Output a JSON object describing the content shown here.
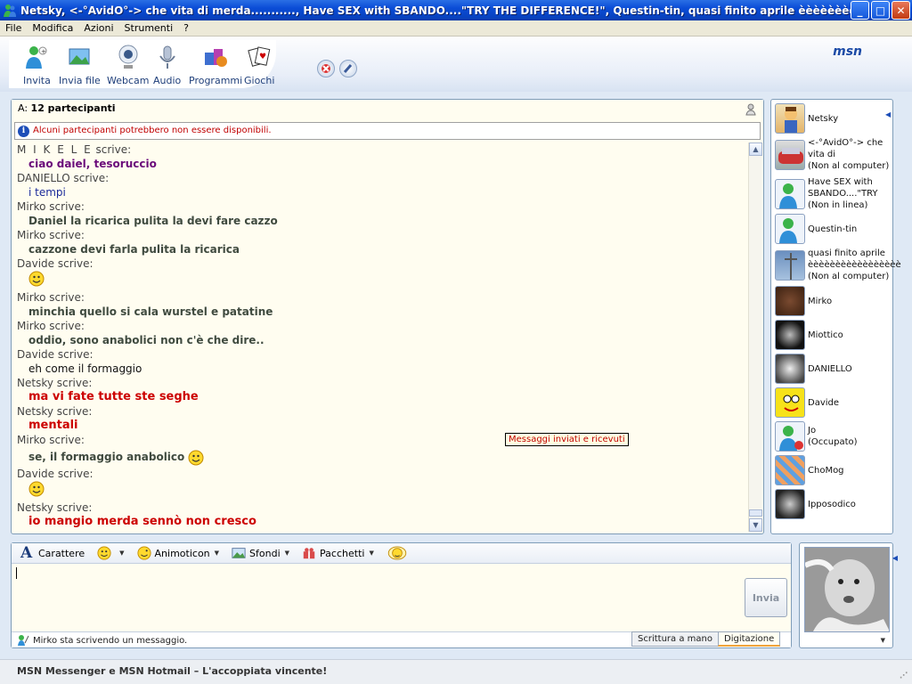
{
  "window": {
    "title": "Netsky, <-°AvidO°->  che vita di merda..........., Have SEX with SBANDO....\"TRY THE DIFFERENCE!\", Questin-tin, quasi finito aprile èèèèèèèèèèèèèèèèèèèèèèèèèèèèè..."
  },
  "menu": [
    "File",
    "Modifica",
    "Azioni",
    "Strumenti",
    "?"
  ],
  "toolbar": {
    "invite": "Invita",
    "send_file": "Invia file",
    "webcam": "Webcam",
    "audio": "Audio",
    "programs": "Programmi",
    "games": "Giochi",
    "logo": "msn"
  },
  "conversation": {
    "to_label": "A:",
    "participants": "12 partecipanti",
    "warning": "Alcuni partecipanti potrebbero non essere disponibili.",
    "messages": [
      {
        "who": "M I K E L E",
        "suffix": " scrive:",
        "text": "ciao daiel, tesoruccio"
      },
      {
        "who": "DANIELLO",
        "suffix": " scrive:",
        "text": "i tempi"
      },
      {
        "who": "Mirko",
        "suffix": " scrive:",
        "text": "Daniel la ricarica pulita la devi fare cazzo"
      },
      {
        "who": "Mirko",
        "suffix": " scrive:",
        "text": "cazzone devi farla pulita la ricarica"
      },
      {
        "who": "Davide",
        "suffix": " scrive:",
        "text": ""
      },
      {
        "who": "Mirko",
        "suffix": " scrive:",
        "text": "minchia quello si cala wurstel e patatine"
      },
      {
        "who": "Mirko",
        "suffix": " scrive:",
        "text": "oddio, sono anabolici non c'è che dire.."
      },
      {
        "who": "Davide",
        "suffix": " scrive:",
        "text": "eh come il formaggio"
      },
      {
        "who": "Netsky",
        "suffix": " scrive:",
        "text": "ma vi fate tutte ste seghe"
      },
      {
        "who": "Netsky",
        "suffix": " scrive:",
        "text": "mentali"
      },
      {
        "who": "Mirko",
        "suffix": " scrive:",
        "text": "se, il formaggio anabolico"
      },
      {
        "who": "Davide",
        "suffix": " scrive:",
        "text": ""
      },
      {
        "who": "Netsky",
        "suffix": " scrive:",
        "text": "io mangio merda sennò non cresco"
      }
    ],
    "tooltip": "Messaggi inviati e ricevuti"
  },
  "contacts": [
    {
      "name": "Netsky",
      "status": ""
    },
    {
      "name": "<-°AvidO°->  che vita di",
      "status": "(Non al computer)"
    },
    {
      "name": "Have SEX with SBANDO....\"TRY",
      "status": "(Non in linea)"
    },
    {
      "name": "Questin-tin",
      "status": ""
    },
    {
      "name": "quasi finito aprile èèèèèèèèèèèèèèèèè",
      "status": "(Non al computer)"
    },
    {
      "name": "Mirko",
      "status": ""
    },
    {
      "name": "Miottico",
      "status": ""
    },
    {
      "name": "DANIELLO",
      "status": ""
    },
    {
      "name": "Davide",
      "status": ""
    },
    {
      "name": "Jo",
      "status": "(Occupato)"
    },
    {
      "name": "ChoMog",
      "status": ""
    },
    {
      "name": "Ipposodico",
      "status": ""
    }
  ],
  "compose": {
    "font_label": "Carattere",
    "animoticons_label": "Animoticon",
    "backgrounds_label": "Sfondi",
    "packages_label": "Pacchetti",
    "send_label": "Invia",
    "typing_status": "Mirko sta scrivendo un messaggio.",
    "handwriting_tab": "Scrittura a mano",
    "typing_tab": "Digitazione"
  },
  "footer": {
    "ad_text": "MSN Messenger e MSN Hotmail – L'accoppiata vincente!"
  }
}
